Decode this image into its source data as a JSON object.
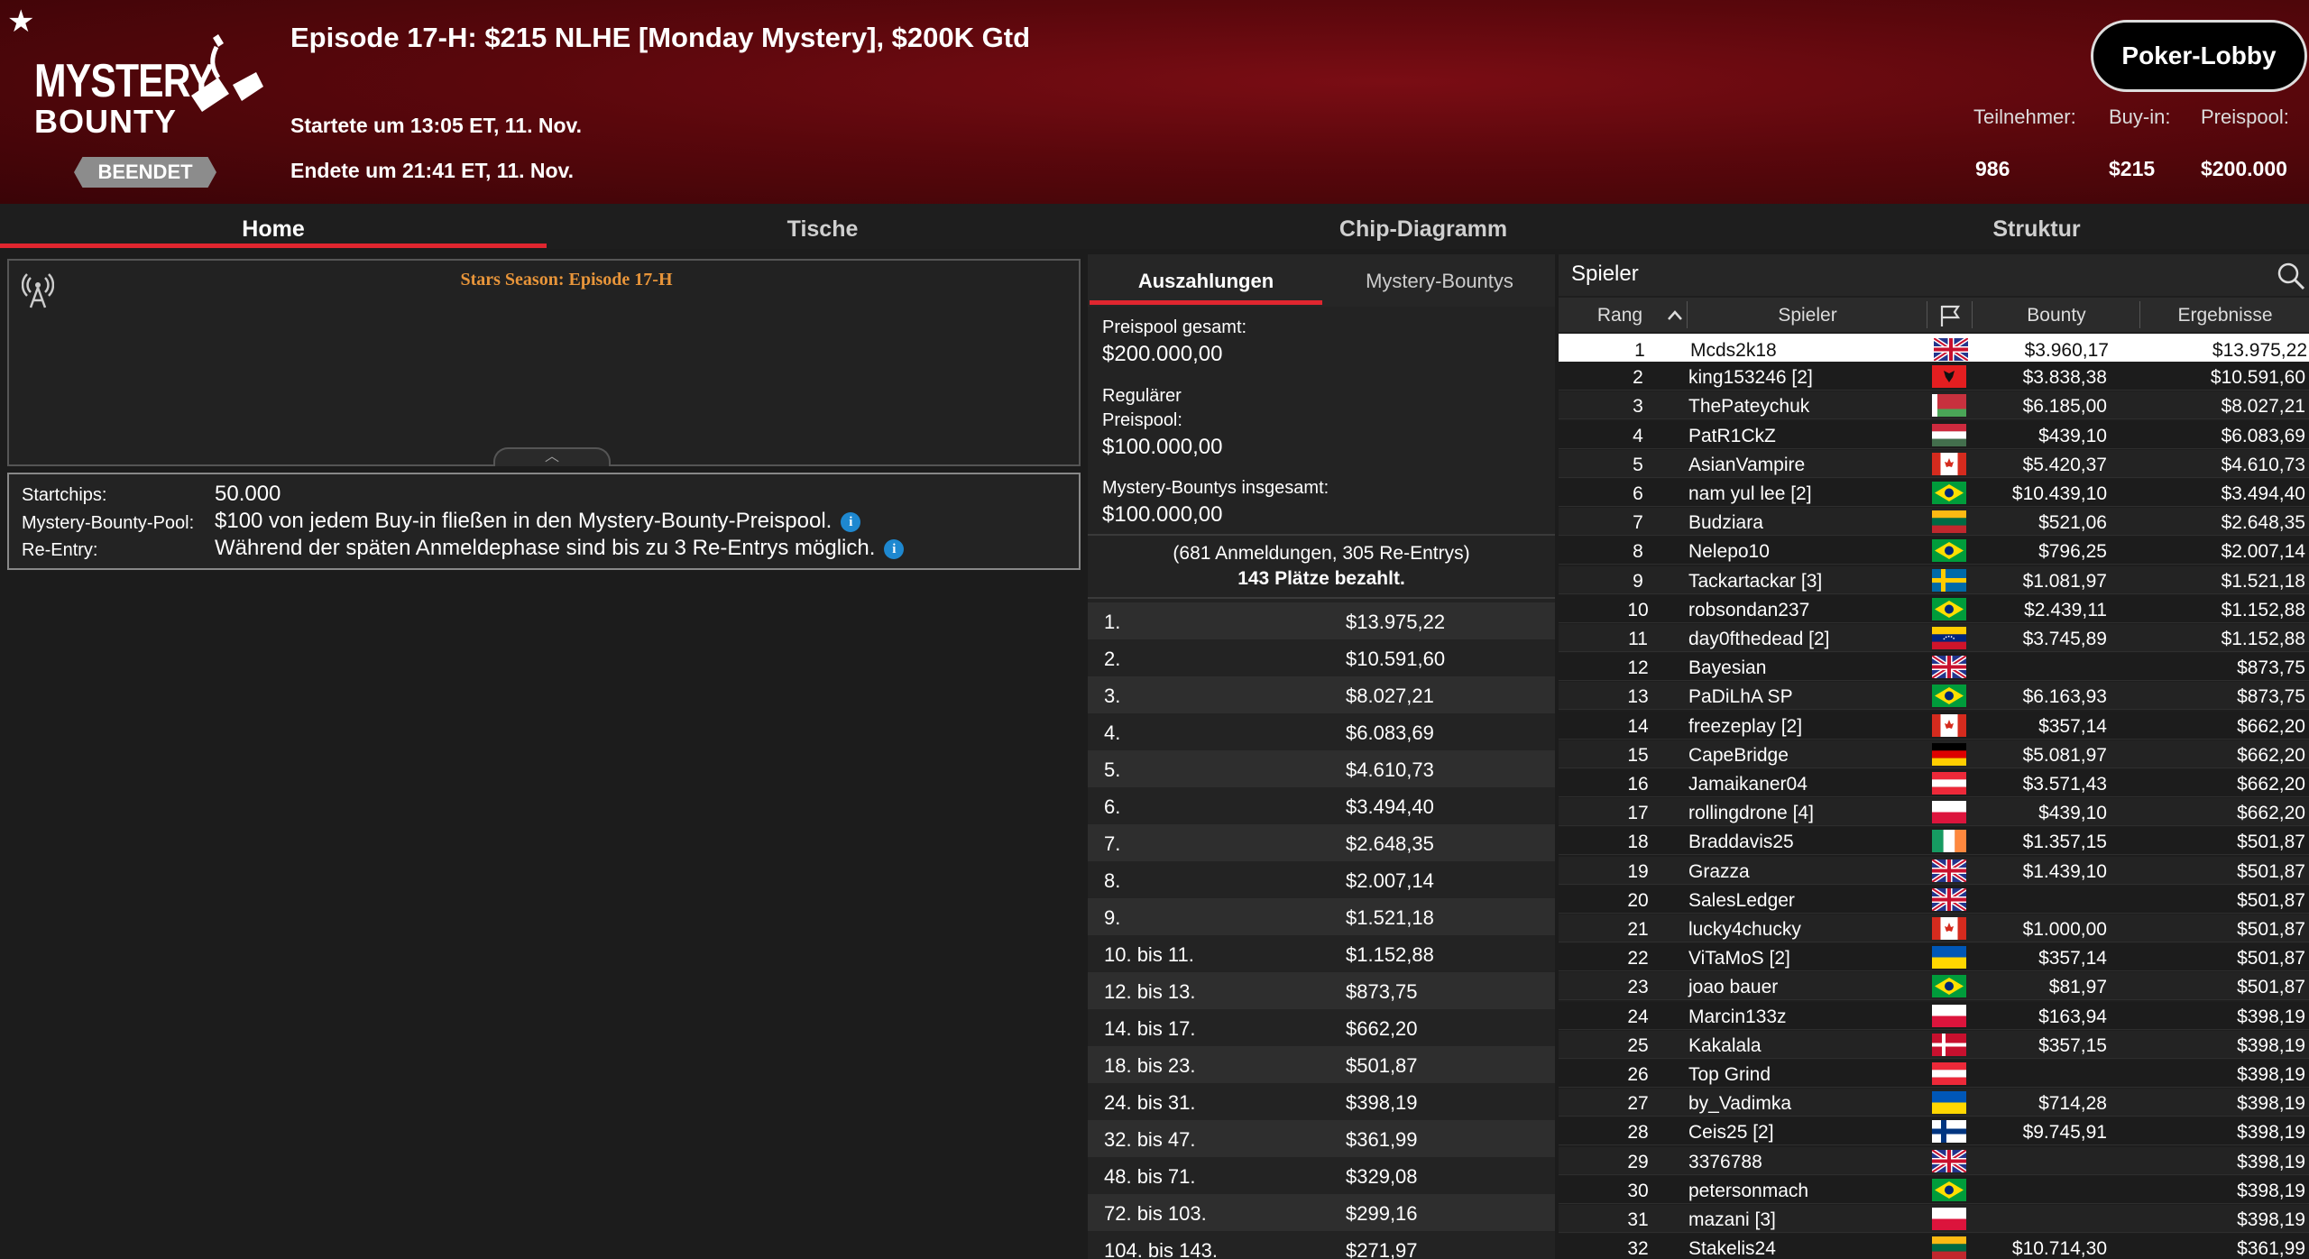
{
  "header": {
    "title": "Episode 17-H: $215 NLHE [Monday Mystery], $200K Gtd",
    "logo_line1": "MYSTERY",
    "logo_line2": "BOUNTY",
    "status": "BEENDET",
    "started": "Startete um 13:05 ET, 11. Nov.",
    "ended": "Endete um 21:41 ET, 11. Nov.",
    "lobby_button": "Poker-Lobby",
    "stats": [
      {
        "label": "Teilnehmer:",
        "value": "986"
      },
      {
        "label": "Buy-in:",
        "value": "$215"
      },
      {
        "label": "Preispool:",
        "value": "$200.000"
      }
    ]
  },
  "tabs": [
    "Home",
    "Tische",
    "Chip-Diagramm",
    "Struktur"
  ],
  "chat": {
    "title": "Stars Season: Episode 17-H"
  },
  "info": [
    {
      "label": "Startchips:",
      "value": "50.000",
      "has_icon": false
    },
    {
      "label": "Mystery-Bounty-Pool:",
      "value": "$100 von jedem Buy-in fließen in den Mystery-Bounty-Preispool.",
      "has_icon": true
    },
    {
      "label": "Re-Entry:",
      "value": "Während der späten Anmeldephase sind bis zu 3 Re-Entrys möglich.",
      "has_icon": true
    }
  ],
  "payouts": {
    "tabs": [
      "Auszahlungen",
      "Mystery-Bountys"
    ],
    "total_label": "Preispool gesamt:",
    "total_value": "$200.000,00",
    "regular_label_1": "Regulärer",
    "regular_label_2": "Preispool:",
    "regular_value": "$100.000,00",
    "bounty_label": "Mystery-Bountys insgesamt:",
    "bounty_value": "$100.000,00",
    "entries_line": "(681 Anmeldungen, 305 Re-Entrys)",
    "paid_line": "143 Plätze bezahlt.",
    "rows": [
      {
        "place": "1.",
        "amount": "$13.975,22"
      },
      {
        "place": "2.",
        "amount": "$10.591,60"
      },
      {
        "place": "3.",
        "amount": "$8.027,21"
      },
      {
        "place": "4.",
        "amount": "$6.083,69"
      },
      {
        "place": "5.",
        "amount": "$4.610,73"
      },
      {
        "place": "6.",
        "amount": "$3.494,40"
      },
      {
        "place": "7.",
        "amount": "$2.648,35"
      },
      {
        "place": "8.",
        "amount": "$2.007,14"
      },
      {
        "place": "9.",
        "amount": "$1.521,18"
      },
      {
        "place": "10. bis 11.",
        "amount": "$1.152,88"
      },
      {
        "place": "12. bis 13.",
        "amount": "$873,75"
      },
      {
        "place": "14. bis 17.",
        "amount": "$662,20"
      },
      {
        "place": "18. bis 23.",
        "amount": "$501,87"
      },
      {
        "place": "24. bis 31.",
        "amount": "$398,19"
      },
      {
        "place": "32. bis 47.",
        "amount": "$361,99"
      },
      {
        "place": "48. bis 71.",
        "amount": "$329,08"
      },
      {
        "place": "72. bis 103.",
        "amount": "$299,16"
      },
      {
        "place": "104. bis 143.",
        "amount": "$271,97"
      }
    ]
  },
  "players": {
    "search_label": "Spieler",
    "columns": [
      "Rang",
      "Spieler",
      "Bounty",
      "Ergebnisse"
    ],
    "rows": [
      {
        "rank": "1",
        "name": "Mcds2k18",
        "flag": "uk",
        "bounty": "$3.960,17",
        "result": "$13.975,22"
      },
      {
        "rank": "2",
        "name": "king153246 [2]",
        "flag": "albania",
        "bounty": "$3.838,38",
        "result": "$10.591,60"
      },
      {
        "rank": "3",
        "name": "ThePateychuk",
        "flag": "belarus",
        "bounty": "$6.185,00",
        "result": "$8.027,21"
      },
      {
        "rank": "4",
        "name": "PatR1CkZ",
        "flag": "hungary",
        "bounty": "$439,10",
        "result": "$6.083,69"
      },
      {
        "rank": "5",
        "name": "AsianVampire",
        "flag": "canada",
        "bounty": "$5.420,37",
        "result": "$4.610,73"
      },
      {
        "rank": "6",
        "name": "nam yul lee [2]",
        "flag": "brazil",
        "bounty": "$10.439,10",
        "result": "$3.494,40"
      },
      {
        "rank": "7",
        "name": "Budziara",
        "flag": "lithuania",
        "bounty": "$521,06",
        "result": "$2.648,35"
      },
      {
        "rank": "8",
        "name": "Nelepo10",
        "flag": "brazil",
        "bounty": "$796,25",
        "result": "$2.007,14"
      },
      {
        "rank": "9",
        "name": "Tackartackar [3]",
        "flag": "sweden",
        "bounty": "$1.081,97",
        "result": "$1.521,18"
      },
      {
        "rank": "10",
        "name": "robsondan237",
        "flag": "brazil",
        "bounty": "$2.439,11",
        "result": "$1.152,88"
      },
      {
        "rank": "11",
        "name": "day0fthedead [2]",
        "flag": "venezuela",
        "bounty": "$3.745,89",
        "result": "$1.152,88"
      },
      {
        "rank": "12",
        "name": "Bayesian",
        "flag": "uk",
        "bounty": "",
        "result": "$873,75"
      },
      {
        "rank": "13",
        "name": "PaDiLhA SP",
        "flag": "brazil",
        "bounty": "$6.163,93",
        "result": "$873,75"
      },
      {
        "rank": "14",
        "name": "freezeplay [2]",
        "flag": "canada",
        "bounty": "$357,14",
        "result": "$662,20"
      },
      {
        "rank": "15",
        "name": "CapeBridge",
        "flag": "germany",
        "bounty": "$5.081,97",
        "result": "$662,20"
      },
      {
        "rank": "16",
        "name": "Jamaikaner04",
        "flag": "austria",
        "bounty": "$3.571,43",
        "result": "$662,20"
      },
      {
        "rank": "17",
        "name": "rollingdrone [4]",
        "flag": "poland",
        "bounty": "$439,10",
        "result": "$662,20"
      },
      {
        "rank": "18",
        "name": "Braddavis25",
        "flag": "ireland",
        "bounty": "$1.357,15",
        "result": "$501,87"
      },
      {
        "rank": "19",
        "name": "Grazza",
        "flag": "uk",
        "bounty": "$1.439,10",
        "result": "$501,87"
      },
      {
        "rank": "20",
        "name": "SalesLedger",
        "flag": "uk",
        "bounty": "",
        "result": "$501,87"
      },
      {
        "rank": "21",
        "name": "lucky4chucky",
        "flag": "canada",
        "bounty": "$1.000,00",
        "result": "$501,87"
      },
      {
        "rank": "22",
        "name": "ViTaMoS [2]",
        "flag": "ukraine",
        "bounty": "$357,14",
        "result": "$501,87"
      },
      {
        "rank": "23",
        "name": "joao bauer",
        "flag": "brazil",
        "bounty": "$81,97",
        "result": "$501,87"
      },
      {
        "rank": "24",
        "name": "Marcin133z",
        "flag": "poland",
        "bounty": "$163,94",
        "result": "$398,19"
      },
      {
        "rank": "25",
        "name": "Kakalala",
        "flag": "denmark",
        "bounty": "$357,15",
        "result": "$398,19"
      },
      {
        "rank": "26",
        "name": "Top Grind",
        "flag": "austria",
        "bounty": "",
        "result": "$398,19"
      },
      {
        "rank": "27",
        "name": "by_Vadimka",
        "flag": "ukraine",
        "bounty": "$714,28",
        "result": "$398,19"
      },
      {
        "rank": "28",
        "name": "Ceis25 [2]",
        "flag": "finland",
        "bounty": "$9.745,91",
        "result": "$398,19"
      },
      {
        "rank": "29",
        "name": "3376788",
        "flag": "uk",
        "bounty": "",
        "result": "$398,19"
      },
      {
        "rank": "30",
        "name": "petersonmach",
        "flag": "brazil",
        "bounty": "",
        "result": "$398,19"
      },
      {
        "rank": "31",
        "name": "mazani [3]",
        "flag": "poland",
        "bounty": "",
        "result": "$398,19"
      },
      {
        "rank": "32",
        "name": "Stakelis24",
        "flag": "lithuania",
        "bounty": "$10.714,30",
        "result": "$361,99"
      }
    ]
  },
  "colors": {
    "accent": "#e0262f",
    "header_red": "#6a0a10",
    "chat_title": "#e8953a",
    "info_icon": "#1e88d0"
  }
}
